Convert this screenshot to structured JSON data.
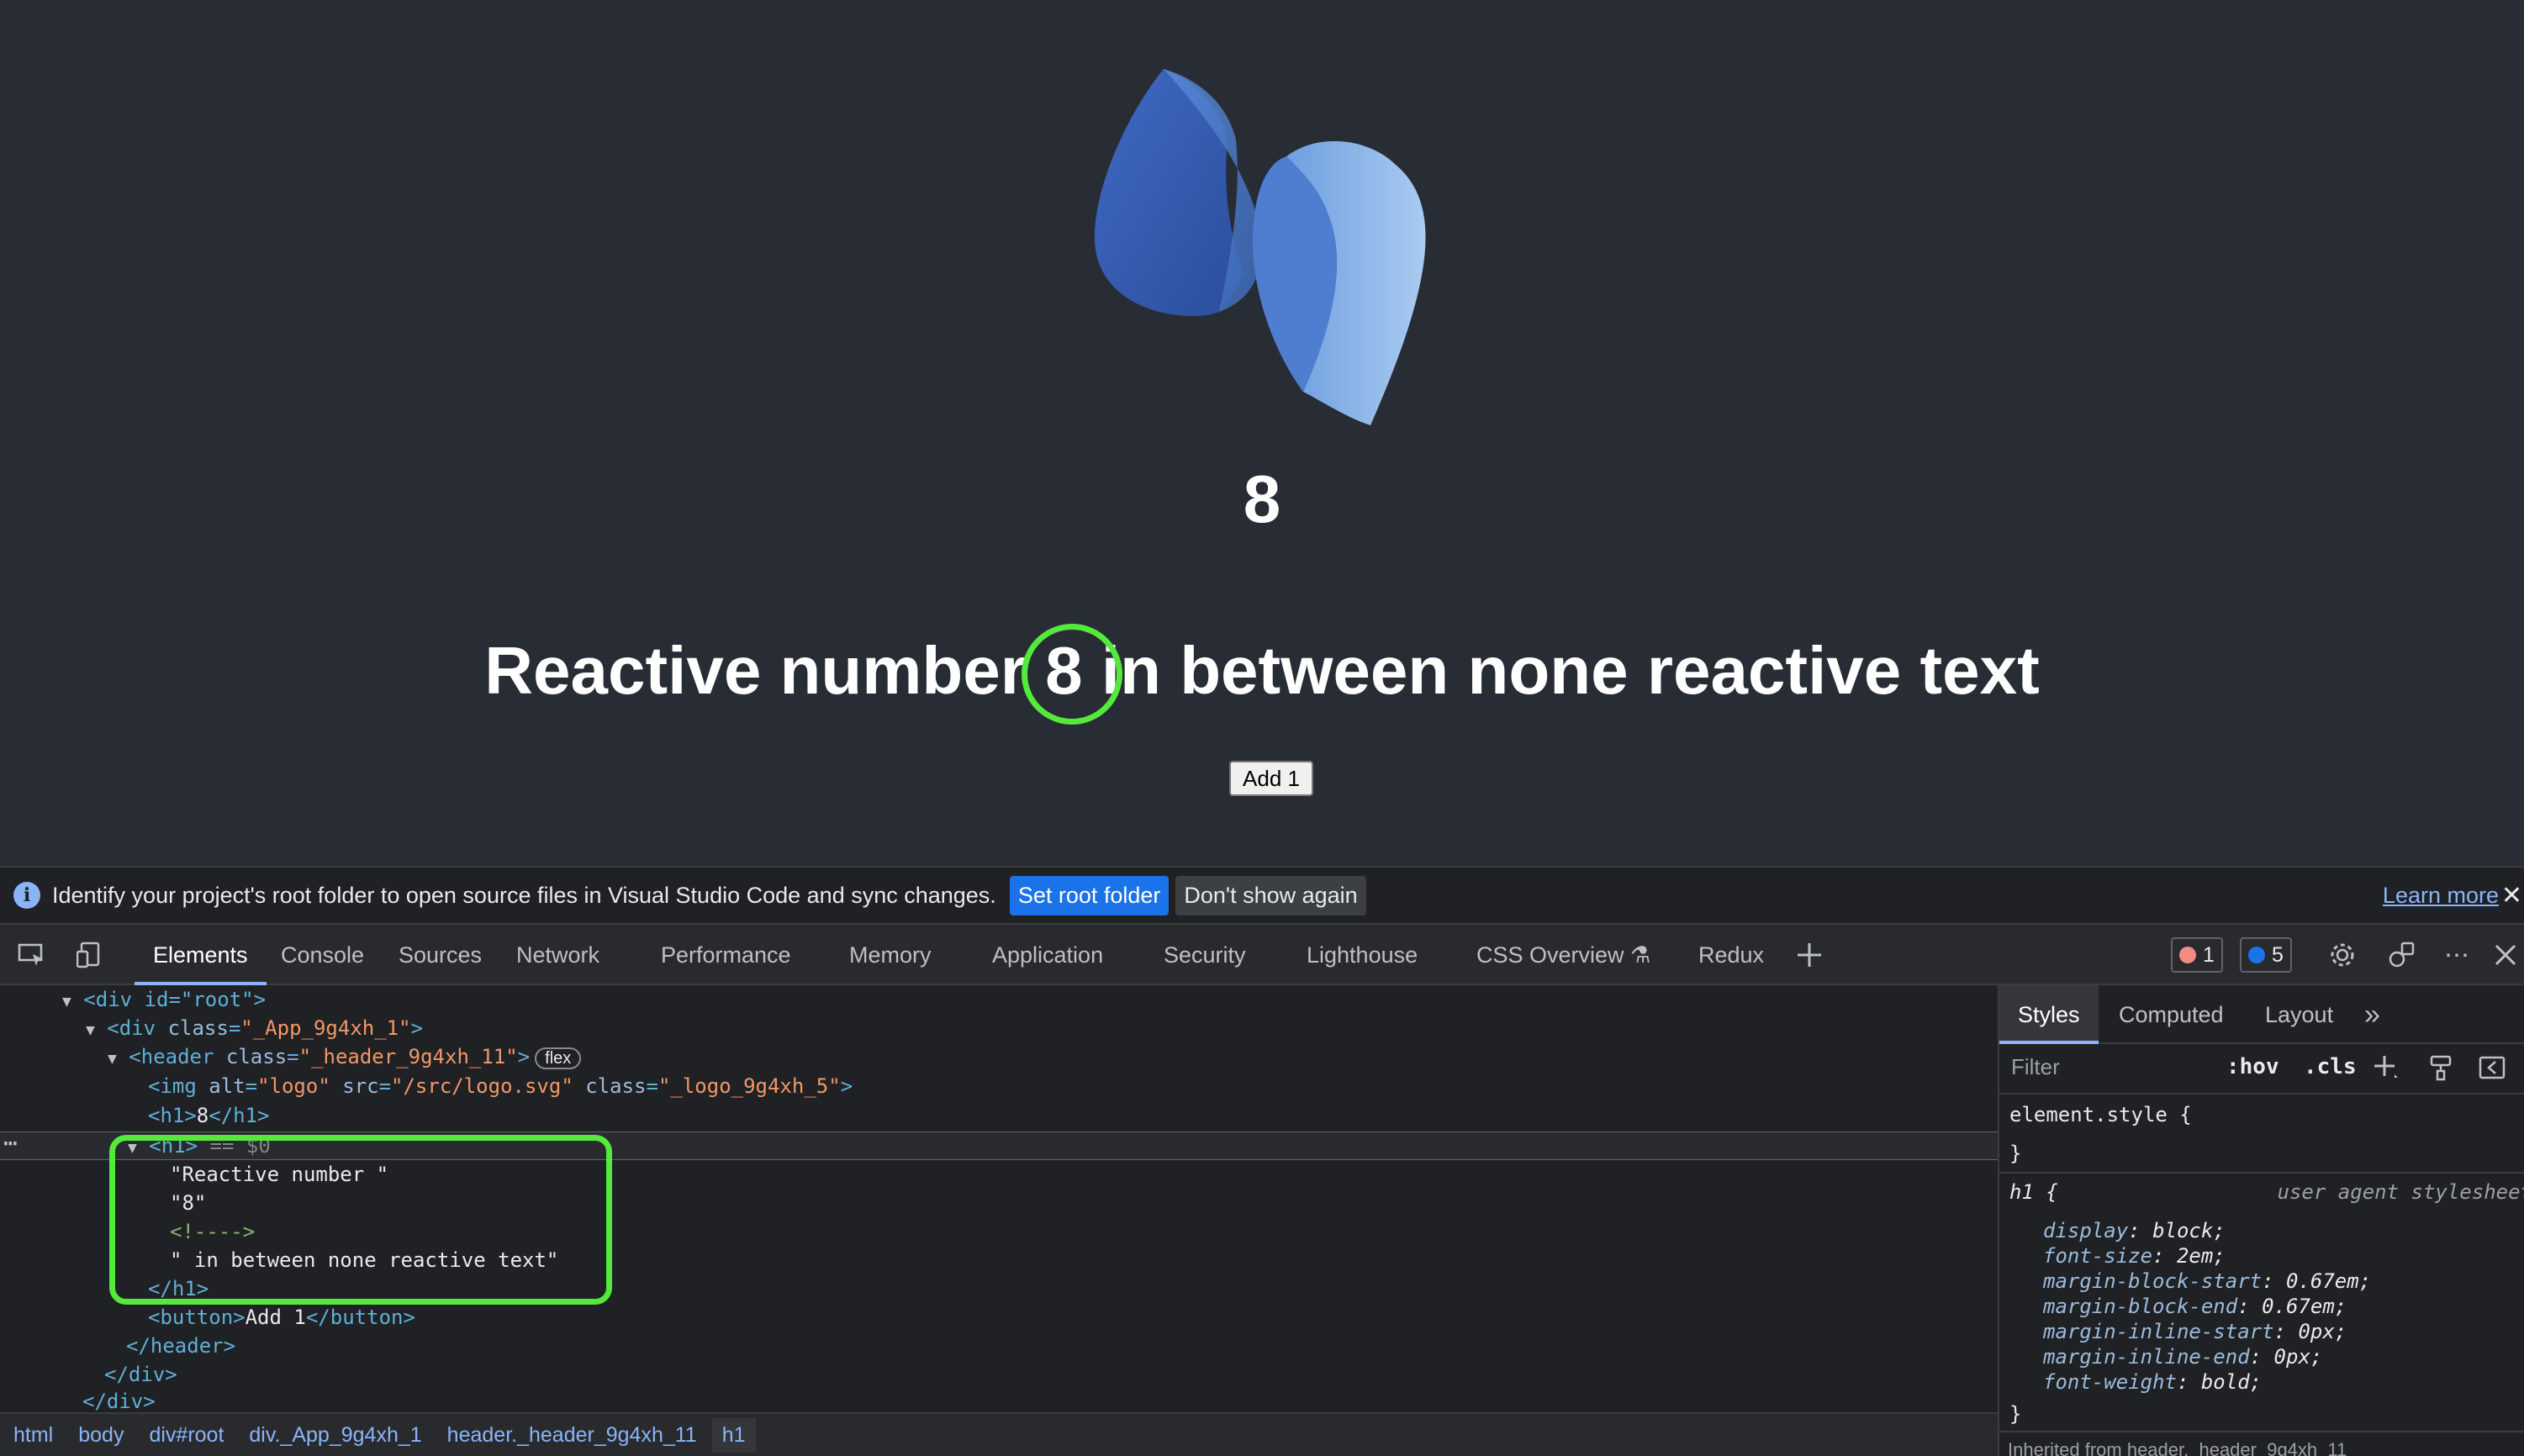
{
  "app": {
    "count": "8",
    "reactive": {
      "before": "Reactive number ",
      "number": "8",
      "after": " in between none reactive text"
    },
    "add_button": "Add 1"
  },
  "infobar": {
    "message": "Identify your project's root folder to open source files in Visual Studio Code and sync changes.",
    "set_root": "Set root folder",
    "dont_show": "Don't show again",
    "learn_more": "Learn more",
    "info_glyph": "i",
    "close_glyph": "✕"
  },
  "devtools": {
    "tabs": [
      "Elements",
      "Console",
      "Sources",
      "Network",
      "Performance",
      "Memory",
      "Application",
      "Security",
      "Lighthouse",
      "CSS Overview",
      "Redux"
    ],
    "active_tab": "Elements",
    "error_count": "1",
    "message_count": "5",
    "icons": [
      "inspect-icon",
      "device-toolbar-icon",
      "add-tab-icon",
      "settings-icon",
      "customize-icon",
      "more-icon",
      "close-icon"
    ]
  },
  "dom_tree": {
    "root_open": "<div id=\"root\">",
    "app_div_open": {
      "tag": "div",
      "attr": "class",
      "value": "_App_9g4xh_1"
    },
    "header_open": {
      "tag": "header",
      "attr": "class",
      "value": "_header_9g4xh_11",
      "badge": "flex"
    },
    "img": {
      "alt": "logo",
      "src": "/src/logo.svg",
      "class": "_logo_9g4xh_5"
    },
    "h1_first": {
      "open": "<h1>",
      "text": "8",
      "close": "</h1>"
    },
    "h1_selected": {
      "open": "<h1>",
      "marker": "== $0"
    },
    "text_nodes": [
      "\"Reactive number \"",
      "\"8\"",
      "<!---->",
      "\" in between none reactive text\""
    ],
    "h1_close": "</h1>",
    "button_line": {
      "tag": "button",
      "text": "Add 1"
    },
    "header_close": "</header>",
    "div_close_1": "</div>",
    "div_close_2": "</div>"
  },
  "breadcrumb": [
    "html",
    "body",
    "div#root",
    "div._App_9g4xh_1",
    "header._header_9g4xh_11",
    "h1"
  ],
  "styles_pane": {
    "tabs": [
      "Styles",
      "Computed",
      "Layout"
    ],
    "more": "»",
    "filter_placeholder": "Filter",
    "hov": ":hov",
    "cls": ".cls",
    "element_style": "element.style {",
    "close_brace": "}",
    "h1_selector": "h1 {",
    "source": "user agent stylesheet",
    "declarations": [
      {
        "prop": "display",
        "value": "block;"
      },
      {
        "prop": "font-size",
        "value": "2em;"
      },
      {
        "prop": "margin-block-start",
        "value": "0.67em;"
      },
      {
        "prop": "margin-block-end",
        "value": "0.67em;"
      },
      {
        "prop": "margin-inline-start",
        "value": "0px;"
      },
      {
        "prop": "margin-inline-end",
        "value": "0px;"
      },
      {
        "prop": "font-weight",
        "value": "bold;"
      }
    ],
    "inherited": "Inherited from header._header_9g4xh_11"
  },
  "colors": {
    "app_bg": "#282c34",
    "highlight": "#54e93b",
    "devtools_bg": "#202124",
    "accent": "#8ab4f8"
  }
}
